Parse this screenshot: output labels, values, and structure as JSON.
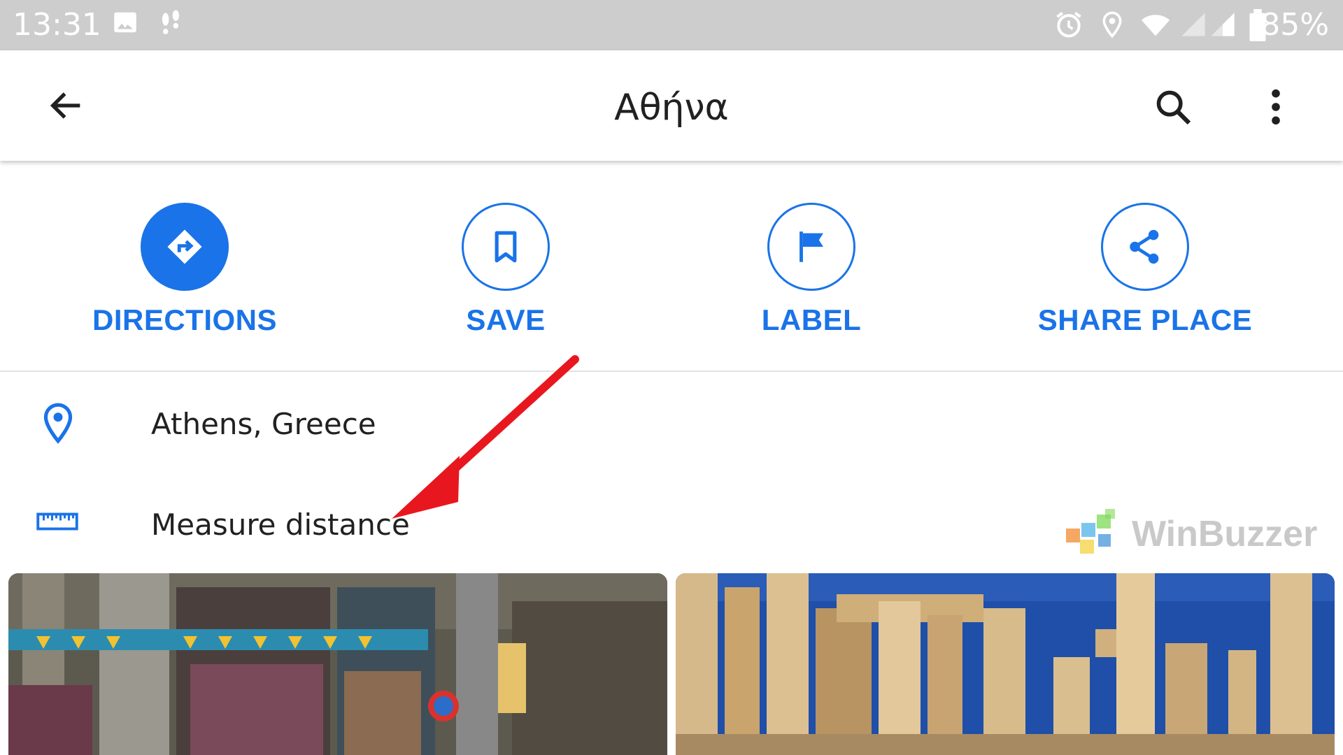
{
  "status_bar": {
    "time": "13:31",
    "battery": "85%",
    "icons": [
      "image-icon",
      "footsteps-icon",
      "alarm-icon",
      "location-icon",
      "wifi-icon",
      "signal-icon",
      "signal-icon",
      "battery-icon"
    ]
  },
  "app_bar": {
    "title": "Αθήνα",
    "icons": [
      "back-arrow-icon",
      "search-icon",
      "more-vert-icon"
    ]
  },
  "actions": [
    {
      "label": "DIRECTIONS",
      "icon": "directions-icon"
    },
    {
      "label": "SAVE",
      "icon": "bookmark-icon"
    },
    {
      "label": "LABEL",
      "icon": "flag-icon"
    },
    {
      "label": "SHARE PLACE",
      "icon": "share-icon"
    }
  ],
  "info_rows": [
    {
      "text": "Athens, Greece",
      "icon": "location-pin-icon"
    },
    {
      "text": "Measure distance",
      "icon": "ruler-icon"
    }
  ],
  "watermark": {
    "text": "WinBuzzer"
  },
  "colors": {
    "accent": "#1a73e8",
    "status_bar": "#cdcdcd",
    "arrow": "#e8171f"
  }
}
